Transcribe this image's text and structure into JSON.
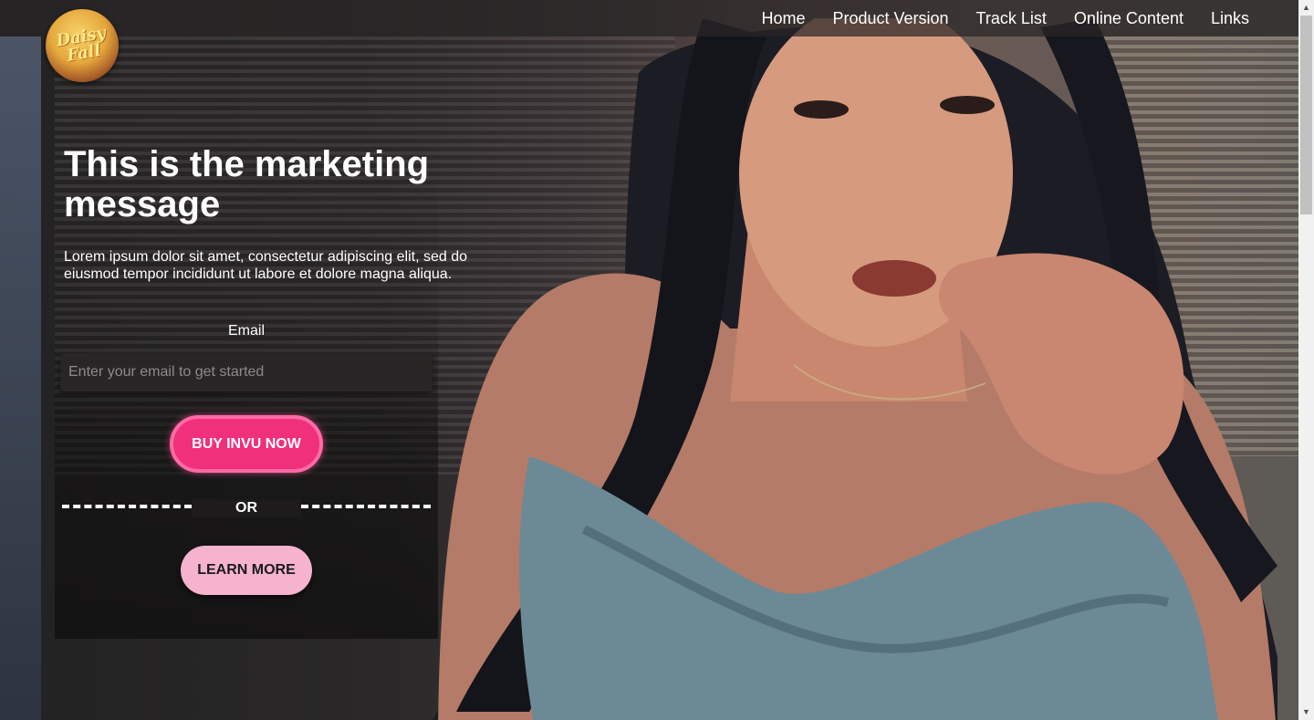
{
  "nav": {
    "items": [
      "Home",
      "Product Version",
      "Track List",
      "Online Content",
      "Links"
    ]
  },
  "logo": {
    "text": "Daisy\nFall"
  },
  "hero": {
    "headline": "This is the marketing message",
    "subtext": "Lorem ipsum dolor sit amet, consectetur adipiscing elit, sed do eiusmod tempor incididunt ut labore et dolore magna aliqua.",
    "image_icon": "woman-portrait-photo"
  },
  "form": {
    "email_label": "Email",
    "email_placeholder": "Enter your email to get started",
    "email_value": "",
    "buy_label": "BUY INVU NOW",
    "or_label": "OR",
    "learn_label": "LEARN MORE"
  },
  "colors": {
    "buy_button": "#f0307a",
    "buy_border": "#ff6aa6",
    "learn_button": "#f5b3cd",
    "navbar_bg": "#282626"
  },
  "scrollbar": {
    "up_icon": "triangle-up-icon",
    "down_icon": "triangle-down-icon"
  }
}
